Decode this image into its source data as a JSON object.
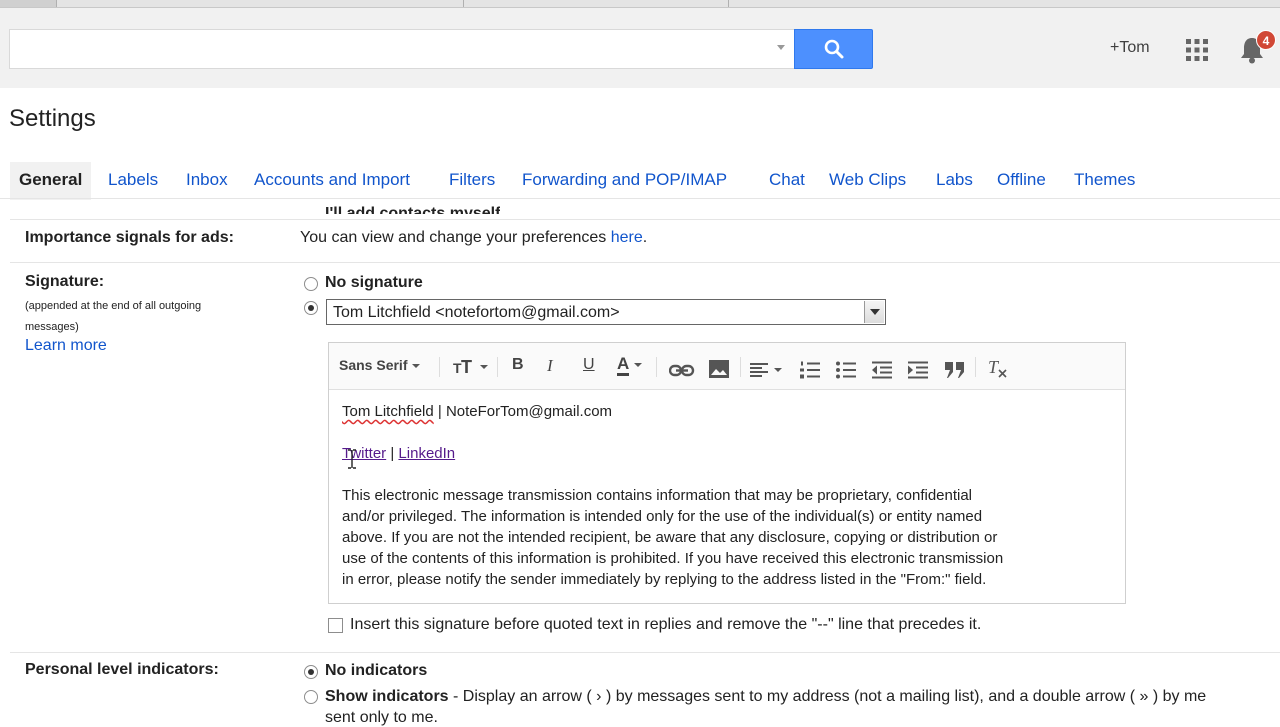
{
  "header": {
    "search_placeholder": "",
    "plus_user": "+Tom",
    "notification_count": "4",
    "accent": "#4d90fe"
  },
  "page": {
    "title": "Settings"
  },
  "tabs": [
    {
      "label": "General",
      "active": true
    },
    {
      "label": "Labels"
    },
    {
      "label": "Inbox"
    },
    {
      "label": "Accounts and Import"
    },
    {
      "label": "Filters"
    },
    {
      "label": "Forwarding and POP/IMAP"
    },
    {
      "label": "Chat"
    },
    {
      "label": "Web Clips"
    },
    {
      "label": "Labs"
    },
    {
      "label": "Offline"
    },
    {
      "label": "Themes"
    }
  ],
  "cutoff_row": {
    "option": "I'll add contacts myself"
  },
  "importance": {
    "label": "Importance signals for ads:",
    "text": "You can view and change your preferences",
    "link": "here",
    "tail": "."
  },
  "signature": {
    "label": "Signature:",
    "sublabel": "(appended at the end of all outgoing messages)",
    "learn_more": "Learn more",
    "no_signature": "No signature",
    "selected_account": "Tom Litchfield <notefortom@gmail.com>",
    "toolbar": {
      "font": "Sans Serif",
      "size_icon": "text-size-icon",
      "bold": "B",
      "italic": "I",
      "underline": "U",
      "color": "A",
      "link_icon": "link-icon",
      "image_icon": "image-icon",
      "align_icon": "align-icon",
      "numbered_list_icon": "numbered-list-icon",
      "bulleted_list_icon": "bulleted-list-icon",
      "indent_less_icon": "indent-less-icon",
      "indent_more_icon": "indent-more-icon",
      "quote_icon": "quote-icon",
      "remove_formatting_icon": "remove-formatting-icon"
    },
    "body": {
      "name": "Tom Litchfield",
      "separator": " | ",
      "email": "NoteForTom@gmail.com",
      "twitter": "Twitter",
      "pipe": " | ",
      "linkedin": "LinkedIn",
      "disclaimer_lines": [
        "This electronic message transmission contains information that may be proprietary, confidential",
        "and/or privileged. The information is intended only for the use of the individual(s) or entity named",
        "above. If you are not the intended recipient, be aware that any disclosure, copying or distribution or",
        "use of the contents of this information is prohibited. If you have received this electronic transmission",
        "in error, please notify the sender immediately by replying to the address listed in the \"From:\" field."
      ]
    },
    "insert_before_quoted": "Insert this signature before quoted text in replies and remove the \"--\" line that precedes it."
  },
  "personal_level": {
    "label": "Personal level indicators:",
    "no_indicators": "No indicators",
    "show_indicators": "Show indicators",
    "show_desc": " - Display an arrow ( › ) by messages sent to my address (not a mailing list), and a double arrow ( » ) by me",
    "show_desc_line2": "sent only to me."
  }
}
